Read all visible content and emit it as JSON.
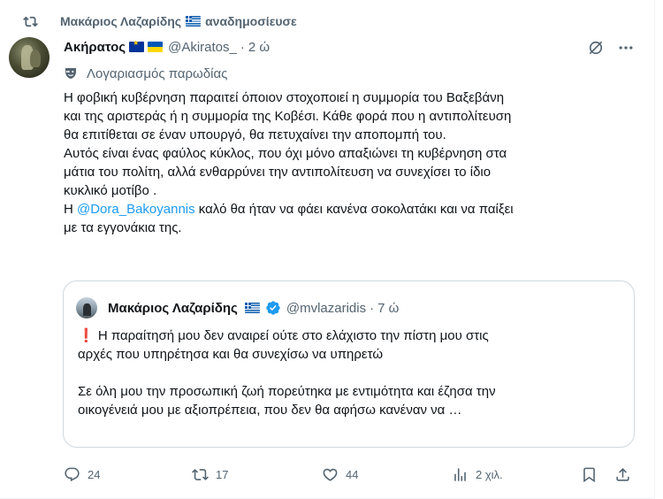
{
  "repost": {
    "label": "Μακάριος Λαζαρίδης",
    "suffix": "αναδημοσίευσε",
    "icon": "repost-icon"
  },
  "post": {
    "display_name": "Ακήρατος",
    "handle": "@Akiratos_",
    "separator": "·",
    "time": "2 ώ",
    "parody_label": "Λογαριασμός παρωδίας",
    "lines": [
      "Η φοβική κυβέρνηση παραιτεί όποιον στοχοποιεί η συμμορία του Βαξεβάνη",
      "και της αριστεράς ή η συμμορία της Κοβέσι. Κάθε φορά που η αντιπολίτευση",
      "θα επιτίθεται σε έναν υπουργό, θα πετυχαίνει την αποπομπή του.",
      "Αυτός είναι ένας φαύλος κύκλος, που όχι μόνο απαξιώνει τη κυβέρνηση στα",
      "μάτια του πολίτη, αλλά ενθαρρύνει την αντιπολίτευση να συνεχίσει το ίδιο",
      "κυκλικό μοτίβο ."
    ],
    "mention_prefix": "Η ",
    "mention": "@Dora_Bakoyannis",
    "mention_rest": " καλό θα ήταν να φάει κανένα σοκολατάκι και να παίξει",
    "last_line": "με τα εγγονάκια της."
  },
  "quote": {
    "name": "Μακάριος Λαζαρίδης",
    "handle": "@mvlazaridis",
    "separator": "·",
    "time": "7 ώ",
    "line1": "❗ Η παραίτησή μου δεν αναιρεί ούτε στο ελάχιστο την πίστη μου στις",
    "line2": "αρχές που υπηρέτησα και θα συνεχίσω να υπηρετώ",
    "line3": "Σε όλη μου την προσωπική ζωή πορεύτηκα με εντιμότητα και έζησα την",
    "line4": "οικογένειά μου με αξιοπρέπεια, που δεν θα αφήσω κανέναν να …"
  },
  "actions": {
    "replies": "24",
    "reposts": "17",
    "likes": "44",
    "views": "2 χιλ."
  },
  "colors": {
    "text": "#0f1419",
    "secondary": "#536471",
    "link": "#1d9bf0",
    "border": "#cfd9de"
  }
}
